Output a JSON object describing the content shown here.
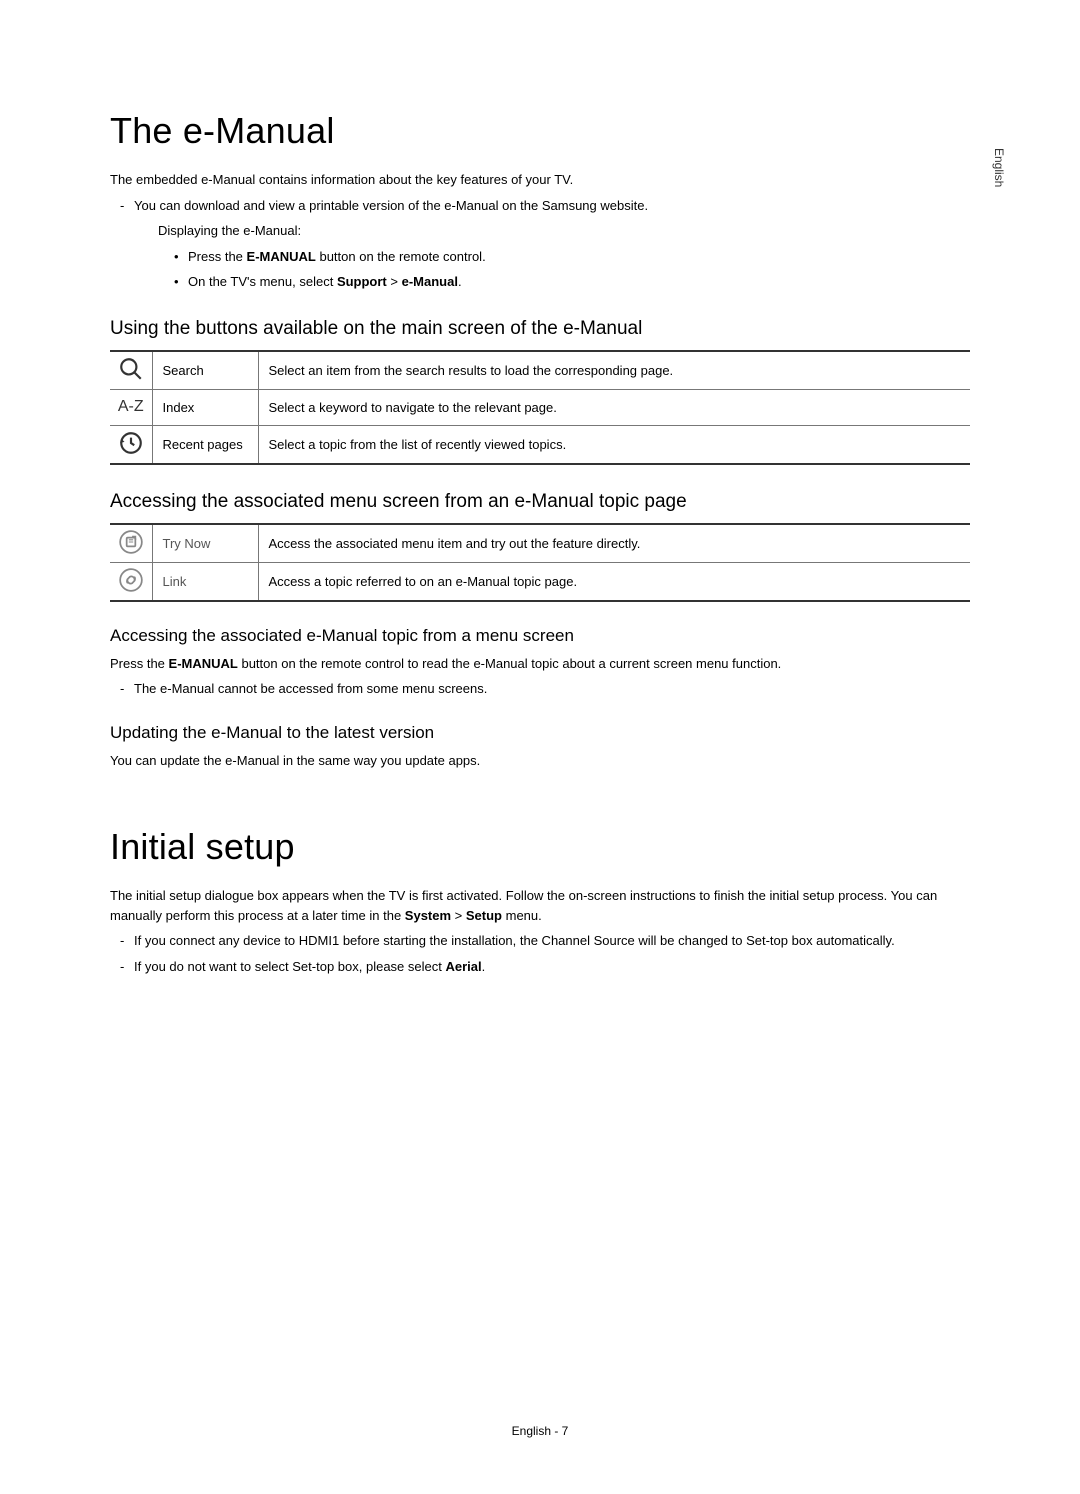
{
  "sideLang": "English",
  "section1": {
    "title": "The e-Manual",
    "intro": "The embedded e-Manual contains information about the key features of your TV.",
    "note1_pre": "You can download and view a printable version of the e-Manual on the Samsung website.",
    "displaying": "Displaying the e-Manual:",
    "bullet1_pre": "Press the ",
    "bullet1_bold": "E-MANUAL",
    "bullet1_post": " button on the remote control.",
    "bullet2_pre": "On the TV's menu, select ",
    "bullet2_b1": "Support",
    "bullet2_mid": " > ",
    "bullet2_b2": "e-Manual",
    "bullet2_post": "."
  },
  "buttonsHeading": "Using the buttons available on the main screen of the e-Manual",
  "table1": {
    "r1": {
      "label": "Search",
      "desc": "Select an item from the search results to load the corresponding page."
    },
    "r2": {
      "label": "Index",
      "desc": "Select a keyword to navigate to the relevant page."
    },
    "r3": {
      "label": "Recent pages",
      "desc": "Select a topic from the list of recently viewed topics."
    }
  },
  "accessHeading": "Accessing the associated menu screen from an e-Manual topic page",
  "table2": {
    "r1": {
      "label": "Try Now",
      "desc": "Access the associated menu item and try out the feature directly."
    },
    "r2": {
      "label": "Link",
      "desc": "Access a topic referred to on an e-Manual topic page."
    }
  },
  "fromMenu": {
    "heading": "Accessing the associated e-Manual topic from a menu screen",
    "p1_pre": "Press the ",
    "p1_bold": "E-MANUAL",
    "p1_post": " button on the remote control to read the e-Manual topic about a current screen menu function.",
    "note": "The e-Manual cannot be accessed from some menu screens."
  },
  "update": {
    "heading": "Updating the e-Manual to the latest version",
    "p": "You can update the e-Manual in the same way you update apps."
  },
  "section2": {
    "title": "Initial setup",
    "p1_pre": "The initial setup dialogue box appears when the TV is first activated. Follow the on-screen instructions to finish the initial setup process. You can manually perform this process at a later time in the ",
    "p1_b1": "System",
    "p1_mid": " > ",
    "p1_b2": "Setup",
    "p1_post": " menu.",
    "note1": "If you connect any device to HDMI1 before starting the installation, the Channel Source will be changed to Set-top box automatically.",
    "note2_pre": "If you do not want to select Set-top box, please select ",
    "note2_bold": "Aerial",
    "note2_post": "."
  },
  "footer": "English - 7"
}
